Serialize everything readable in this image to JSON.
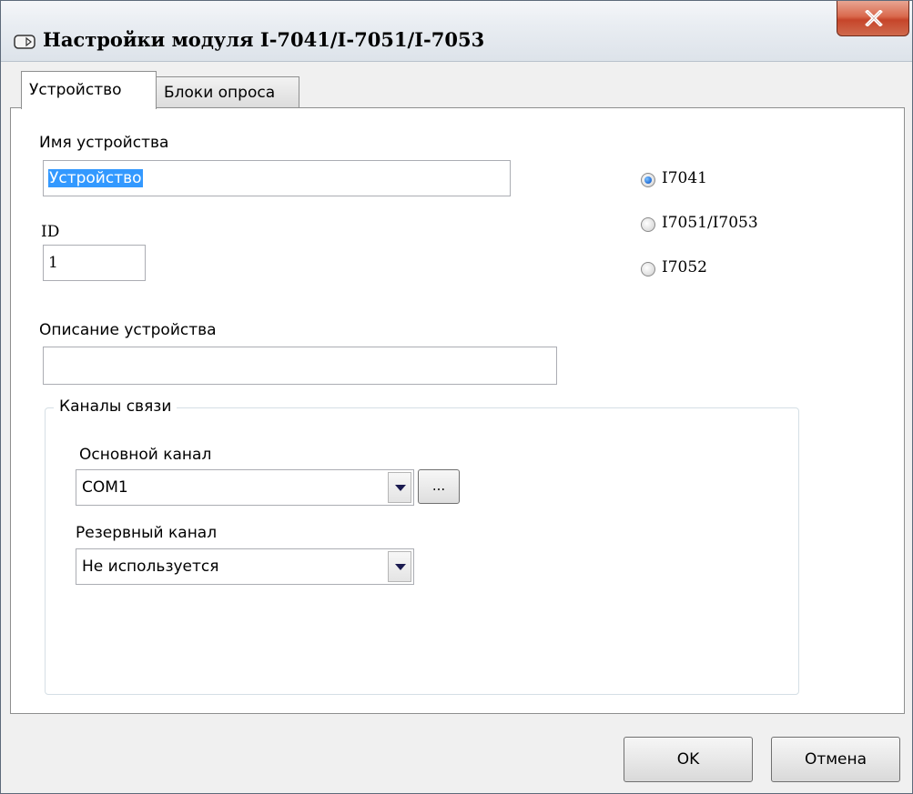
{
  "window": {
    "title": "Настройки модуля I-7041/I-7051/I-7053",
    "close_label": "X"
  },
  "tabs": [
    {
      "label": "Устройство",
      "active": true
    },
    {
      "label": "Блоки опроса",
      "active": false
    }
  ],
  "device": {
    "name_label": "Имя устройства",
    "name_value": "Устройство",
    "id_label": "ID",
    "id_value": "1",
    "description_label": "Описание устройства",
    "description_value": ""
  },
  "module_type": {
    "options": [
      "I7041",
      "I7051/I7053",
      "I7052"
    ],
    "selected": "I7041"
  },
  "channels": {
    "group_title": "Каналы связи",
    "primary_label": "Основной канал",
    "primary_value": "COM1",
    "ellipsis_label": "...",
    "backup_label": "Резервный канал",
    "backup_value": "Не используется"
  },
  "footer": {
    "ok_label": "OK",
    "cancel_label": "Отмена"
  },
  "colors": {
    "selection": "#3399ff",
    "radio_selected": "#1f6bd6",
    "close_button": "#c6452a"
  }
}
